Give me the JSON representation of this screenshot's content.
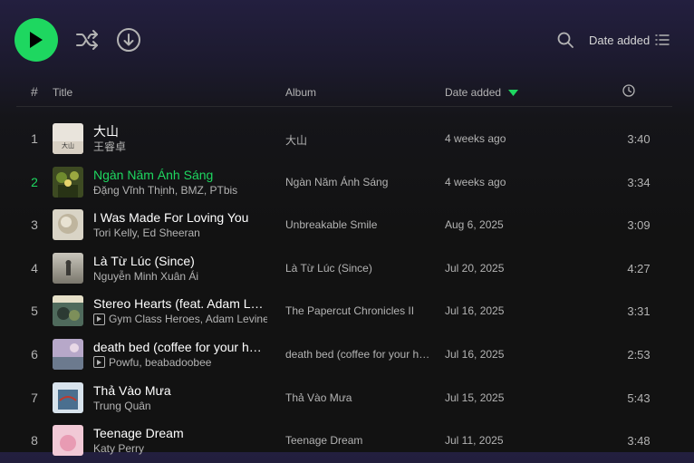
{
  "toolbar": {
    "sort_label": "Date added"
  },
  "header": {
    "num": "#",
    "title": "Title",
    "album": "Album",
    "date_added": "Date added"
  },
  "colors": {
    "accent": "#1ed760",
    "background": "#121212",
    "text_secondary": "#b3b3b3"
  },
  "tracks": [
    {
      "num": "1",
      "title": "大山",
      "artists": "王睿卓",
      "album": "大山",
      "date_added": "4 weeks ago",
      "duration": "3:40",
      "active": false,
      "video": false
    },
    {
      "num": "2",
      "title": "Ngàn Năm Ánh Sáng",
      "artists": "Đặng Vĩnh Thịnh, BMZ, PTbis",
      "album": "Ngàn Năm Ánh Sáng",
      "date_added": "4 weeks ago",
      "duration": "3:34",
      "active": true,
      "video": false
    },
    {
      "num": "3",
      "title": "I Was Made For Loving You",
      "artists": "Tori Kelly, Ed Sheeran",
      "album": "Unbreakable Smile",
      "date_added": "Aug 6, 2025",
      "duration": "3:09",
      "active": false,
      "video": false
    },
    {
      "num": "4",
      "title": "Là Từ Lúc (Since)",
      "artists": "Nguyễn Minh Xuân Ái",
      "album": "Là Từ Lúc (Since)",
      "date_added": "Jul 20, 2025",
      "duration": "4:27",
      "active": false,
      "video": false
    },
    {
      "num": "5",
      "title": "Stereo Hearts (feat. Adam Levine)",
      "artists": "Gym Class Heroes, Adam Levine",
      "album": "The Papercut Chronicles II",
      "date_added": "Jul 16, 2025",
      "duration": "3:31",
      "active": false,
      "video": true
    },
    {
      "num": "6",
      "title": "death bed (coffee for your head)",
      "artists": "Powfu, beabadoobee",
      "album": "death bed (coffee for your head)",
      "date_added": "Jul 16, 2025",
      "duration": "2:53",
      "active": false,
      "video": true
    },
    {
      "num": "7",
      "title": "Thả Vào Mưa",
      "artists": "Trung Quân",
      "album": "Thả Vào Mưa",
      "date_added": "Jul 15, 2025",
      "duration": "5:43",
      "active": false,
      "video": false
    },
    {
      "num": "8",
      "title": "Teenage Dream",
      "artists": "Katy Perry",
      "album": "Teenage Dream",
      "date_added": "Jul 11, 2025",
      "duration": "3:48",
      "active": false,
      "video": false
    }
  ]
}
